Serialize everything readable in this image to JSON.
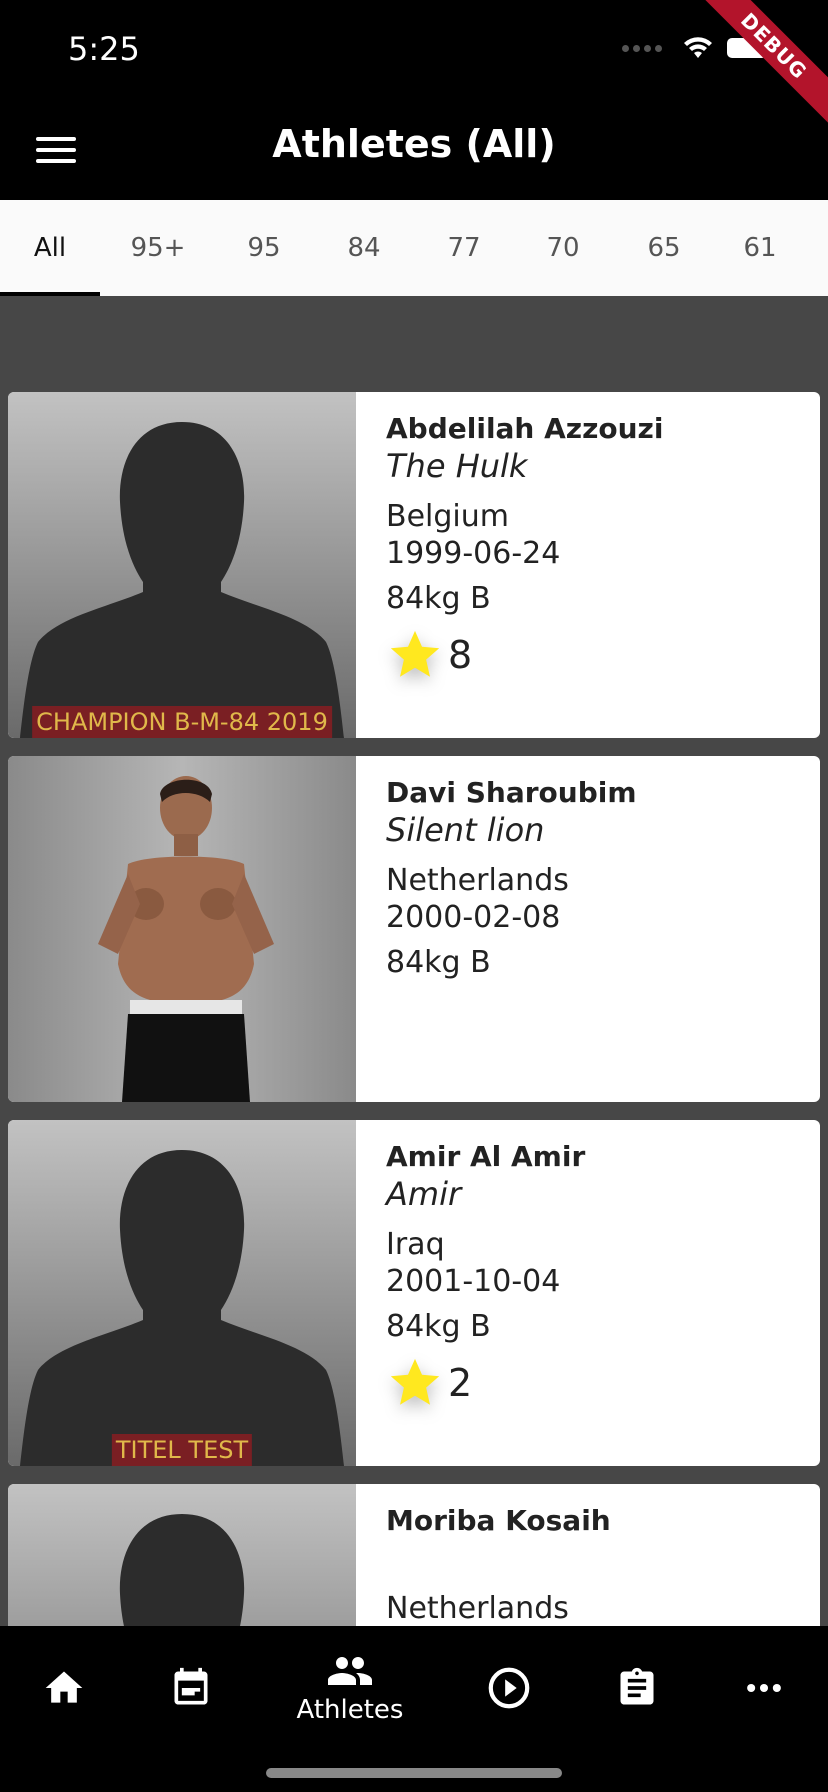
{
  "status": {
    "time": "5:25",
    "debug": "DEBUG"
  },
  "app_bar": {
    "title": "Athletes (All)"
  },
  "tabs": [
    "All",
    "95+",
    "95",
    "84",
    "77",
    "70",
    "65",
    "61"
  ],
  "athletes": [
    {
      "name": "Abdelilah Azzouzi",
      "nickname": "The Hulk",
      "country": "Belgium",
      "dob": "1999-06-24",
      "weight": "84kg  B",
      "stars": "8",
      "title": "CHAMPION B-M-84 2019"
    },
    {
      "name": "Davi Sharoubim",
      "nickname": "Silent lion",
      "country": "Netherlands",
      "dob": "2000-02-08",
      "weight": "84kg  B"
    },
    {
      "name": "Amir Al Amir",
      "nickname": "Amir",
      "country": "Iraq",
      "dob": "2001-10-04",
      "weight": "84kg  B",
      "stars": "2",
      "title": "TITEL TEST"
    },
    {
      "name": "Moriba Kosaih",
      "nickname": "",
      "country": "Netherlands"
    }
  ],
  "bottom_nav": {
    "athletes_label": "Athletes"
  },
  "colors": {
    "star": "#ffe81f",
    "title_bg": "#7a1f23",
    "title_text": "#e0b84a"
  }
}
